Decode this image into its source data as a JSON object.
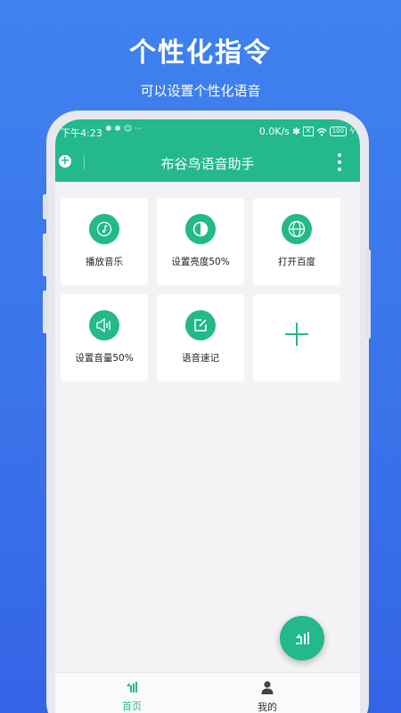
{
  "promo": {
    "title": "个性化指令",
    "subtitle": "可以设置个性化语音"
  },
  "status_bar": {
    "time": "下午4:23",
    "icons_left": "✱ ✱ ☺ ···",
    "network_speed": "0.0K/s",
    "battery": "100"
  },
  "app_bar": {
    "title": "布谷鸟语音助手"
  },
  "commands": [
    {
      "label": "播放音乐",
      "icon": "music-icon"
    },
    {
      "label": "设置亮度50%",
      "icon": "brightness-icon"
    },
    {
      "label": "打开百度",
      "icon": "globe-icon"
    },
    {
      "label": "设置音量50%",
      "icon": "volume-icon"
    },
    {
      "label": "语音速记",
      "icon": "edit-note-icon"
    }
  ],
  "bottom_nav": {
    "home_label": "首页",
    "mine_label": "我的"
  },
  "colors": {
    "accent": "#23b98a",
    "background_top": "#3f82ee",
    "background_bottom": "#3464e6"
  }
}
